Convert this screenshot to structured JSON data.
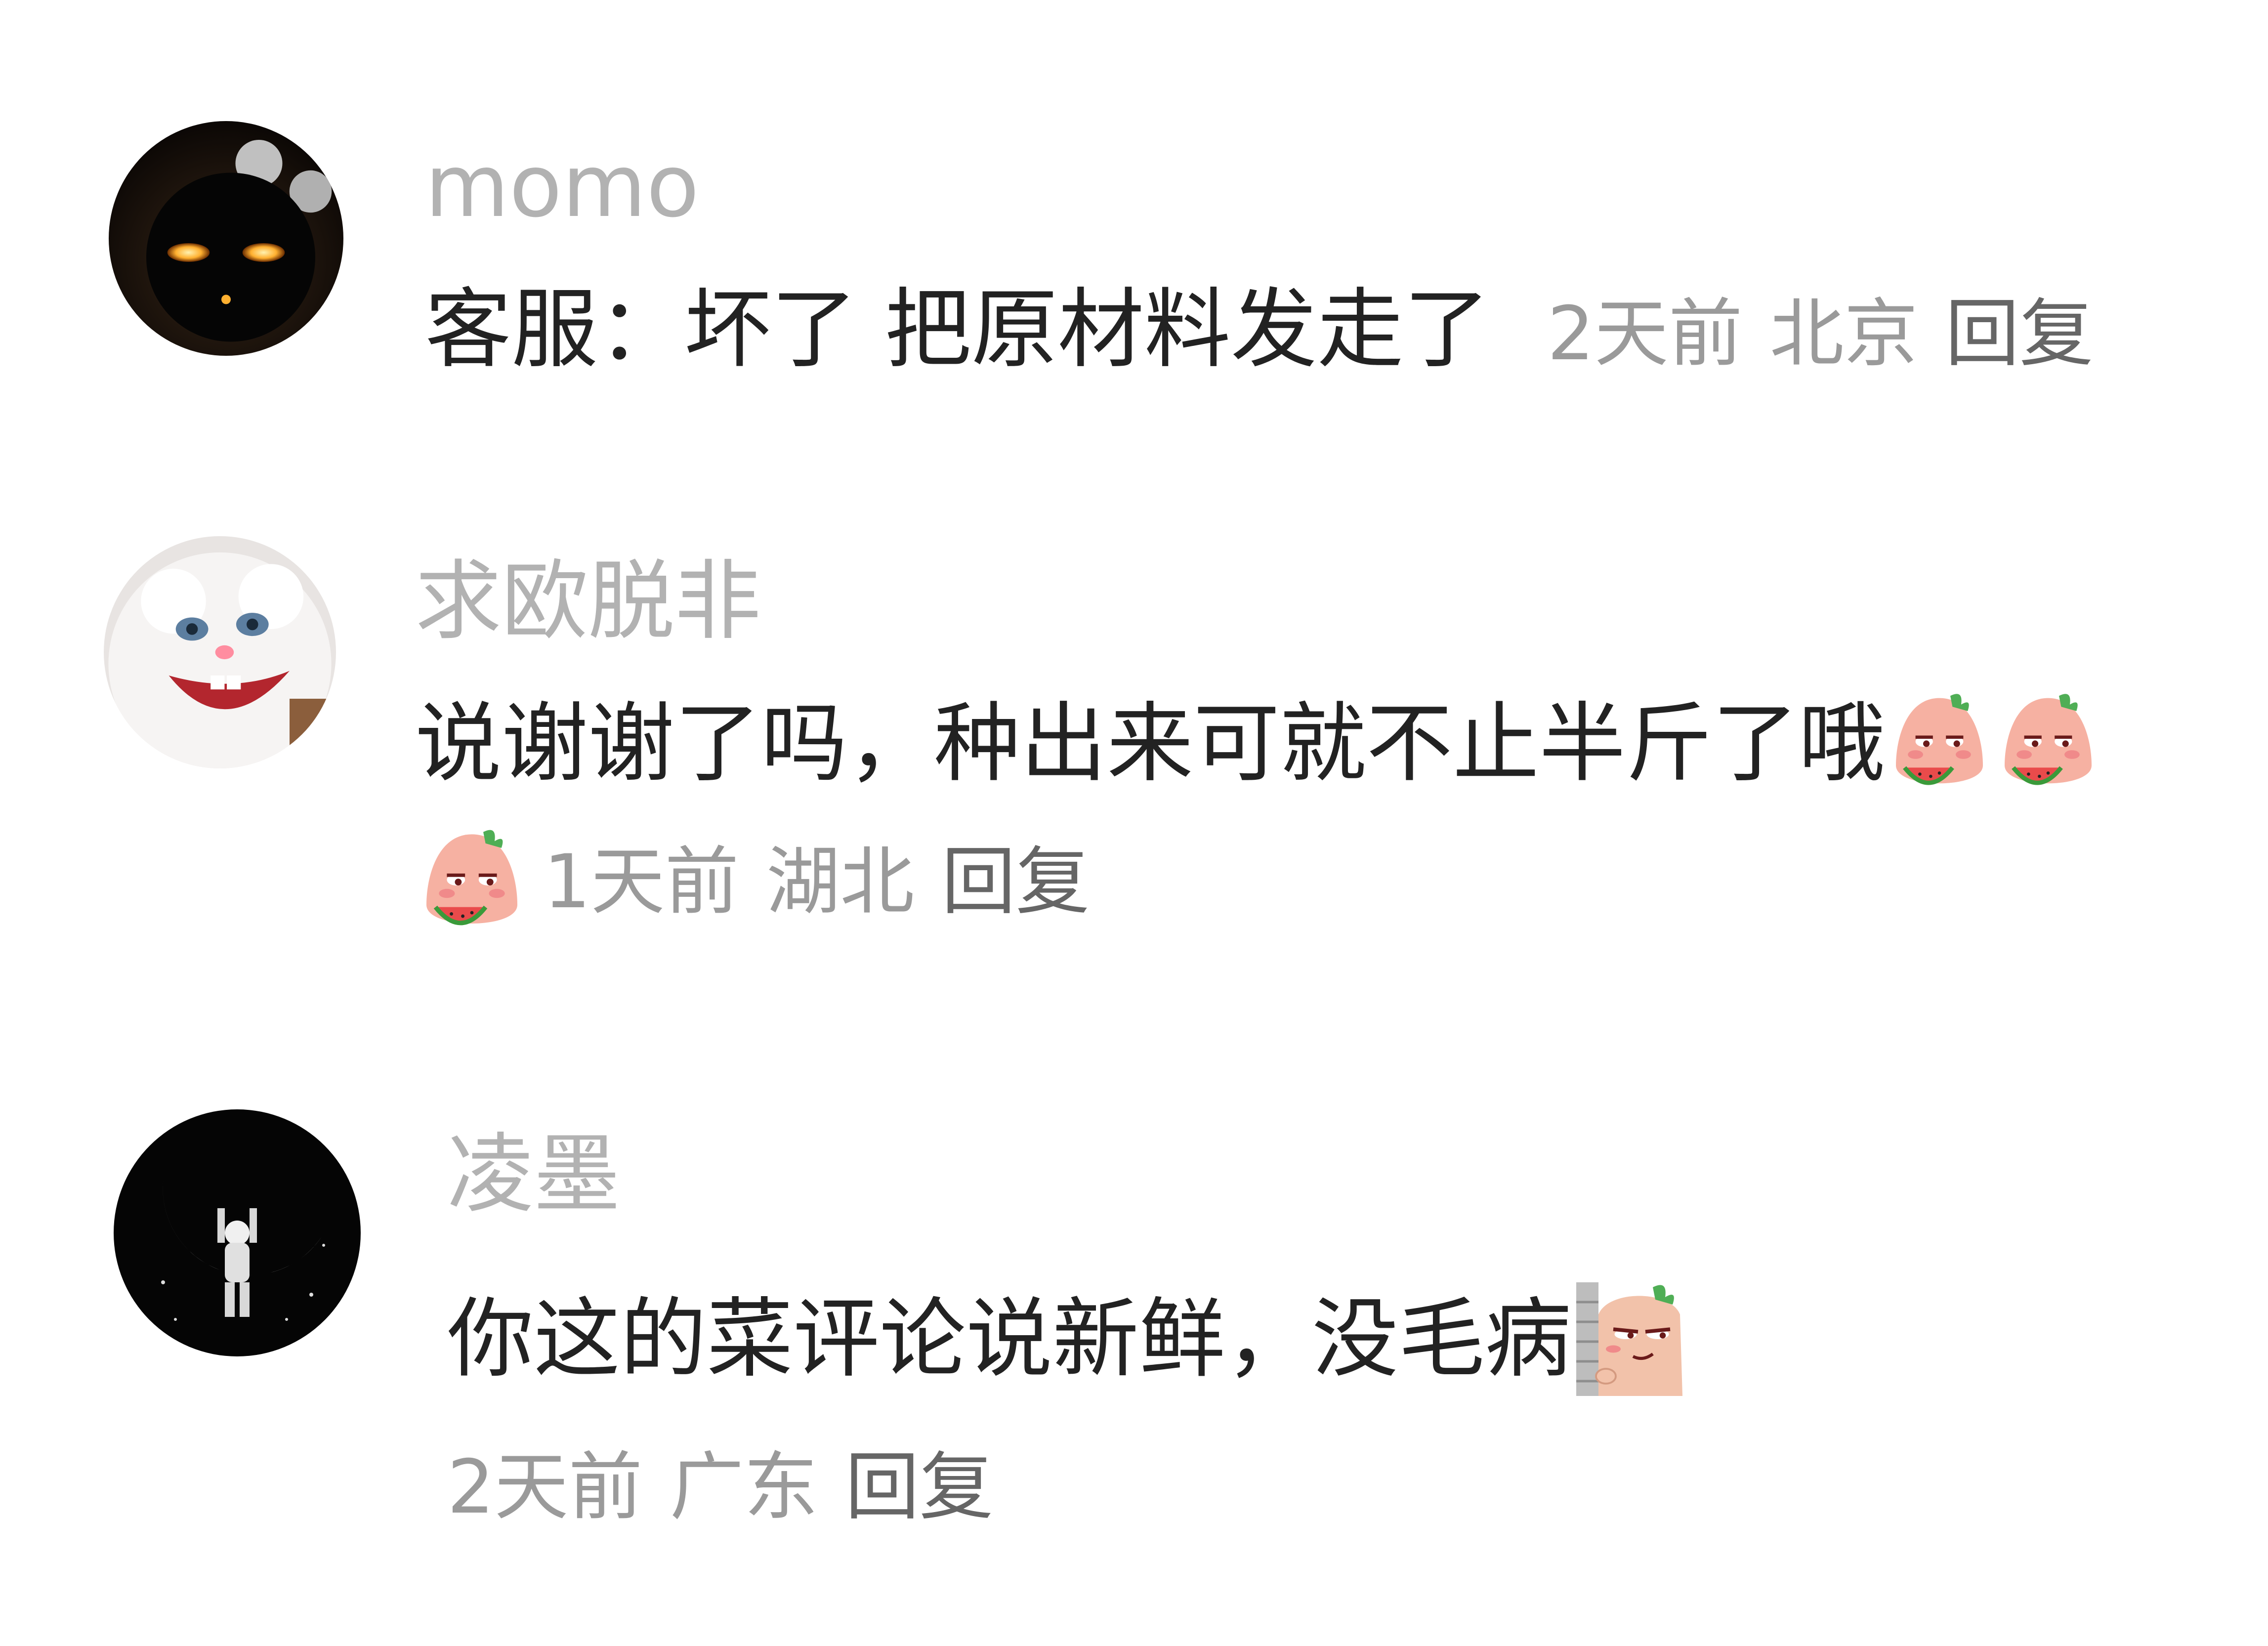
{
  "comments": [
    {
      "username": "momo",
      "text": "客服：坏了 把原材料发走了",
      "time": "2天前",
      "location": "北京",
      "reply_label": "回复",
      "avatar_icon": "dark-mouse-glowing-eyes-avatar"
    },
    {
      "username": "求欧脱非",
      "text": "说谢谢了吗，种出来可就不止半斤了哦",
      "emojis": [
        "watermelon-eating-emoji-icon",
        "watermelon-eating-emoji-icon",
        "watermelon-eating-emoji-icon"
      ],
      "time": "1天前",
      "location": "湖北",
      "reply_label": "回复",
      "avatar_icon": "white-rabbit-snowball-avatar"
    },
    {
      "username": "凌墨",
      "text": "你这的菜评论说新鲜，没毛病",
      "emojis": [
        "peeking-behind-wall-emoji-icon"
      ],
      "time": "2天前",
      "location": "广东",
      "reply_label": "回复",
      "avatar_icon": "astronaut-holding-moon-avatar"
    }
  ],
  "colors": {
    "username": "#b2b2b2",
    "text": "#222222",
    "meta": "#9a9a9a",
    "background": "#ffffff"
  }
}
